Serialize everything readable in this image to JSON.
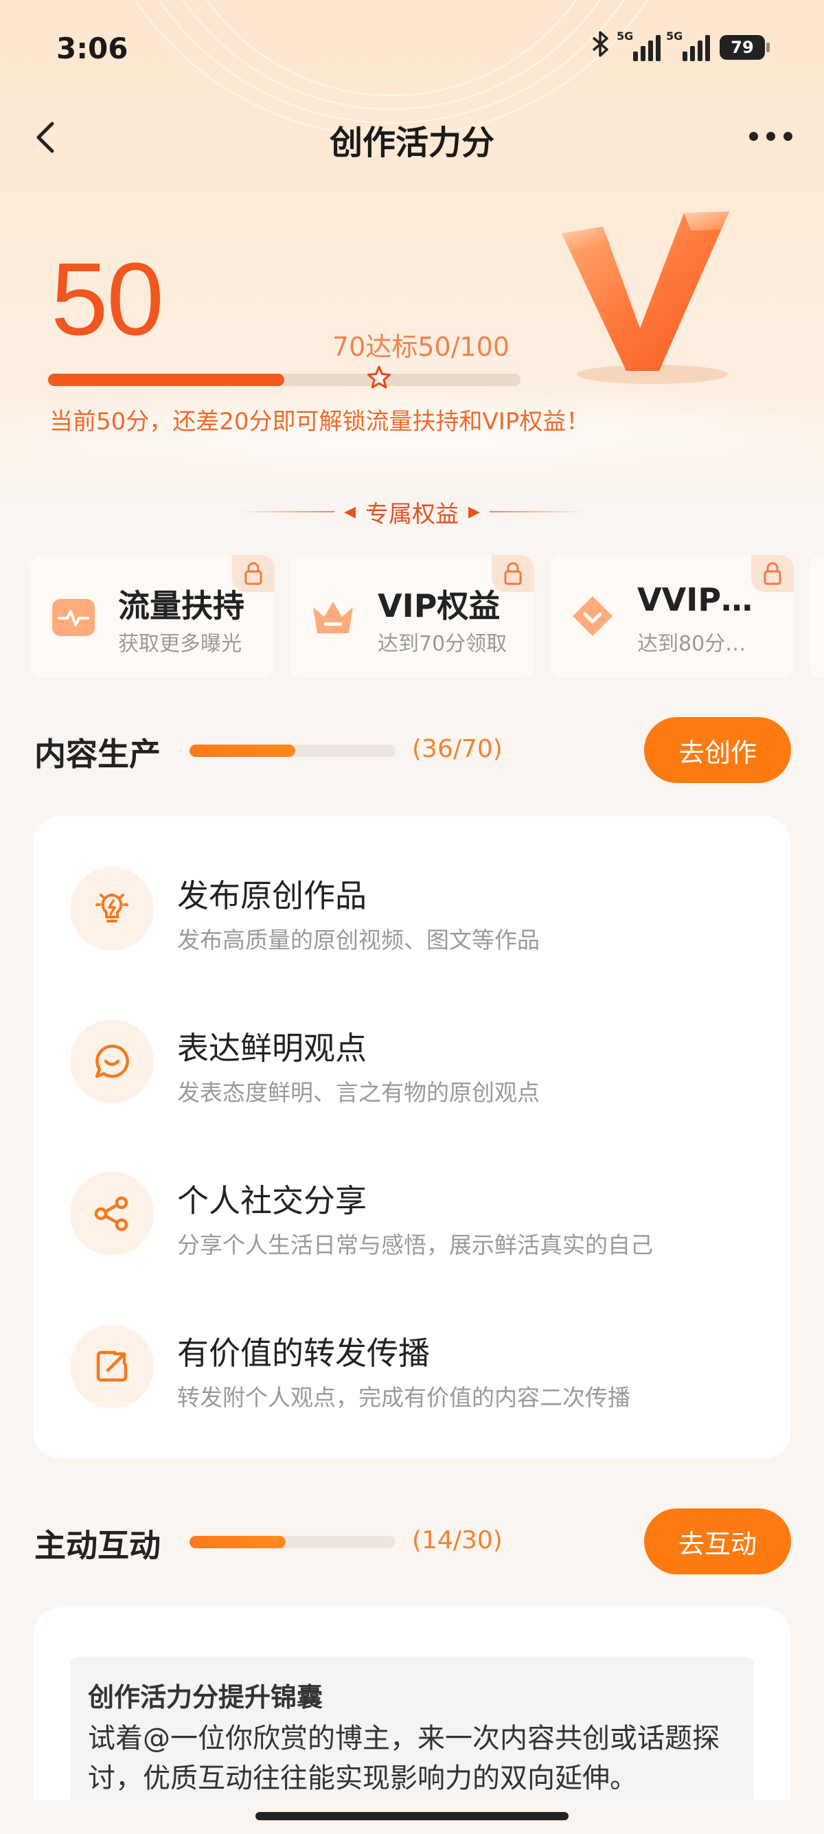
{
  "status_bar": {
    "time": "3:06",
    "signal1_tag": "5G",
    "signal2_tag": "5G",
    "battery": "79"
  },
  "nav": {
    "title": "创作活力分",
    "back_icon": "chevron-left-icon",
    "more_icon": "more-dots-icon"
  },
  "score": {
    "value": "50",
    "target_text": "70达标50/100",
    "progress": 0.5,
    "target_fraction": 0.7,
    "hint": "当前50分，还差20分即可解锁流量扶持和VIP权益！"
  },
  "benefits": {
    "header": "专属权益",
    "cards": [
      {
        "title": "流量扶持",
        "subtitle": "获取更多曝光",
        "icon": "traffic-pulse-icon"
      },
      {
        "title": "VIP权益",
        "subtitle": "达到70分领取",
        "icon": "crown-icon"
      },
      {
        "title": "VVIP…",
        "subtitle": "达到80分…",
        "icon": "diamond-icon"
      }
    ]
  },
  "content_section": {
    "title": "内容生产",
    "count": "(36/70)",
    "progress": 0.514,
    "button": "去创作",
    "items": [
      {
        "title": "发布原创作品",
        "desc": "发布高质量的原创视频、图文等作品",
        "icon": "lightbulb-icon"
      },
      {
        "title": "表达鲜明观点",
        "desc": "发表态度鲜明、言之有物的原创观点",
        "icon": "chat-bubble-icon"
      },
      {
        "title": "个人社交分享",
        "desc": "分享个人生活日常与感悟，展示鲜活真实的自己",
        "icon": "share-icon"
      },
      {
        "title": "有价值的转发传播",
        "desc": "转发附个人观点，完成有价值的内容二次传播",
        "icon": "forward-icon"
      }
    ]
  },
  "interact_section": {
    "title": "主动互动",
    "count": "(14/30)",
    "progress": 0.467,
    "button": "去互动",
    "tip_title": "创作活力分提升锦囊",
    "tip_text": "试着@一位你欣赏的博主，来一次内容共创或话题探讨，优质互动往往能实现影响力的双向延伸。"
  },
  "colors": {
    "accent": "#f0561f",
    "button": "#ff7a10",
    "progress_track": "#ead8c8"
  }
}
